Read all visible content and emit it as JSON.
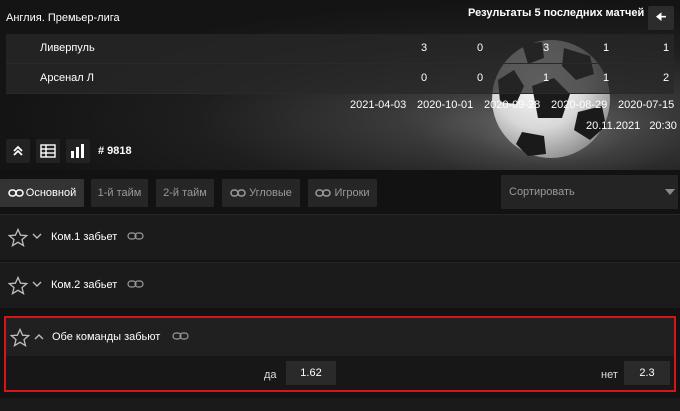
{
  "header": {
    "league": "Англия. Премьер-лига",
    "results_title": "Результаты 5 последних матчей",
    "back_icon": "arrow-left-icon",
    "teams": [
      {
        "name": "Ливерпуль",
        "scores": [
          "3",
          "0",
          "3",
          "1",
          "1"
        ]
      },
      {
        "name": "Арсенал Л",
        "scores": [
          "0",
          "0",
          "1",
          "1",
          "2"
        ]
      }
    ],
    "dates": [
      "2021-04-03",
      "2020-10-01",
      "2020-09-28",
      "2020-08-29",
      "2020-07-15"
    ],
    "match_date": "20.11.2021",
    "match_time": "20:30",
    "match_id": "# 9818"
  },
  "tabs": [
    {
      "label": "Основной",
      "icon": "link-icon",
      "active": true
    },
    {
      "label": "1-й тайм",
      "active": false
    },
    {
      "label": "2-й тайм",
      "active": false
    },
    {
      "label": "Угловые",
      "icon": "link-icon",
      "active": false
    },
    {
      "label": "Игроки",
      "icon": "link-icon",
      "active": false
    }
  ],
  "sort": {
    "label": "Сортировать"
  },
  "markets": [
    {
      "title": "Ком.1 забьет",
      "expanded": false
    },
    {
      "title": "Ком.2 забьет",
      "expanded": false
    }
  ],
  "open_market": {
    "title": "Обе команды забьют",
    "outcomes": [
      {
        "label": "да",
        "odd": "1.62"
      },
      {
        "label": "нет",
        "odd": "2.3"
      }
    ]
  },
  "colors": {
    "highlight": "#d4161b",
    "background": "#121212"
  }
}
